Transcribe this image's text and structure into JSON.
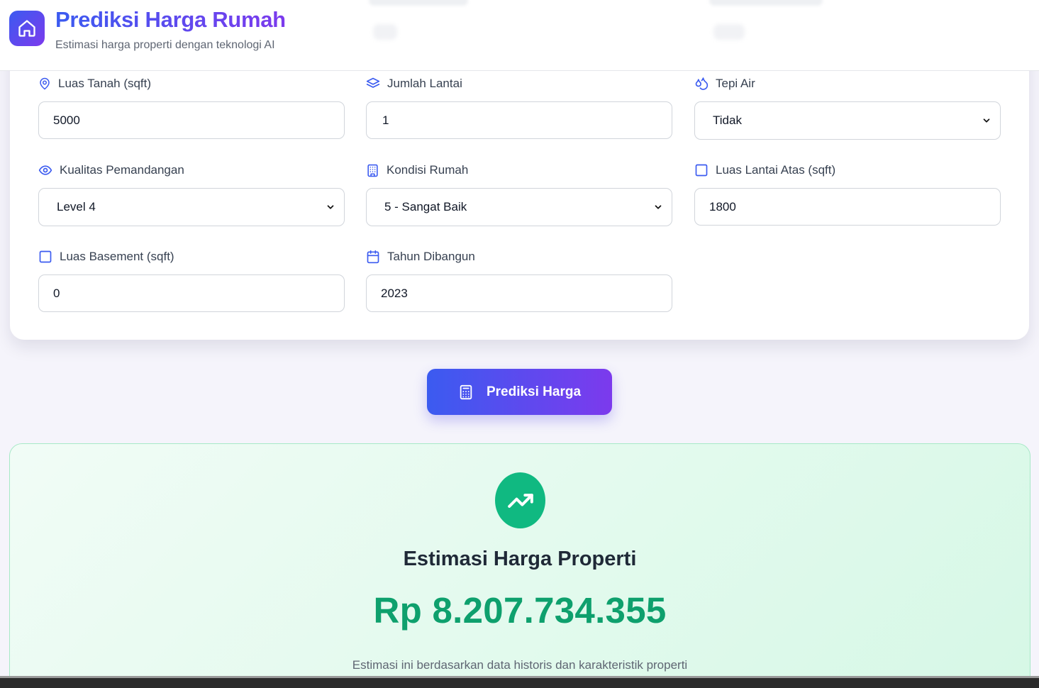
{
  "header": {
    "title": "Prediksi Harga Rumah",
    "subtitle": "Estimasi harga properti dengan teknologi AI",
    "logo_icon": "home-icon"
  },
  "form": {
    "fields": [
      {
        "label": "Luas Tanah (sqft)",
        "icon": "map-pin-icon",
        "type": "input",
        "value": "5000"
      },
      {
        "label": "Jumlah Lantai",
        "icon": "layers-icon",
        "type": "input",
        "value": "1"
      },
      {
        "label": "Tepi Air",
        "icon": "droplets-icon",
        "type": "select",
        "value": "Tidak"
      },
      {
        "label": "Kualitas Pemandangan",
        "icon": "eye-icon",
        "type": "select",
        "value": "Level 4"
      },
      {
        "label": "Kondisi Rumah",
        "icon": "building-icon",
        "type": "select",
        "value": "5 - Sangat Baik"
      },
      {
        "label": "Luas Lantai Atas (sqft)",
        "icon": "square-icon",
        "type": "input",
        "value": "1800"
      },
      {
        "label": "Luas Basement (sqft)",
        "icon": "square-icon",
        "type": "input",
        "value": "0"
      },
      {
        "label": "Tahun Dibangun",
        "icon": "calendar-icon",
        "type": "input",
        "value": "2023"
      }
    ]
  },
  "action": {
    "predict_label": "Prediksi Harga",
    "icon": "calculator-icon"
  },
  "result": {
    "icon": "trending-up-icon",
    "title": "Estimasi Harga Properti",
    "price": "Rp 8.207.734.355",
    "note": "Estimasi ini berdasarkan data historis dan karakteristik properti"
  },
  "colors": {
    "accent_start": "#3b5bf0",
    "accent_end": "#7c3aed",
    "success": "#10b981",
    "price": "#0ea06d"
  }
}
